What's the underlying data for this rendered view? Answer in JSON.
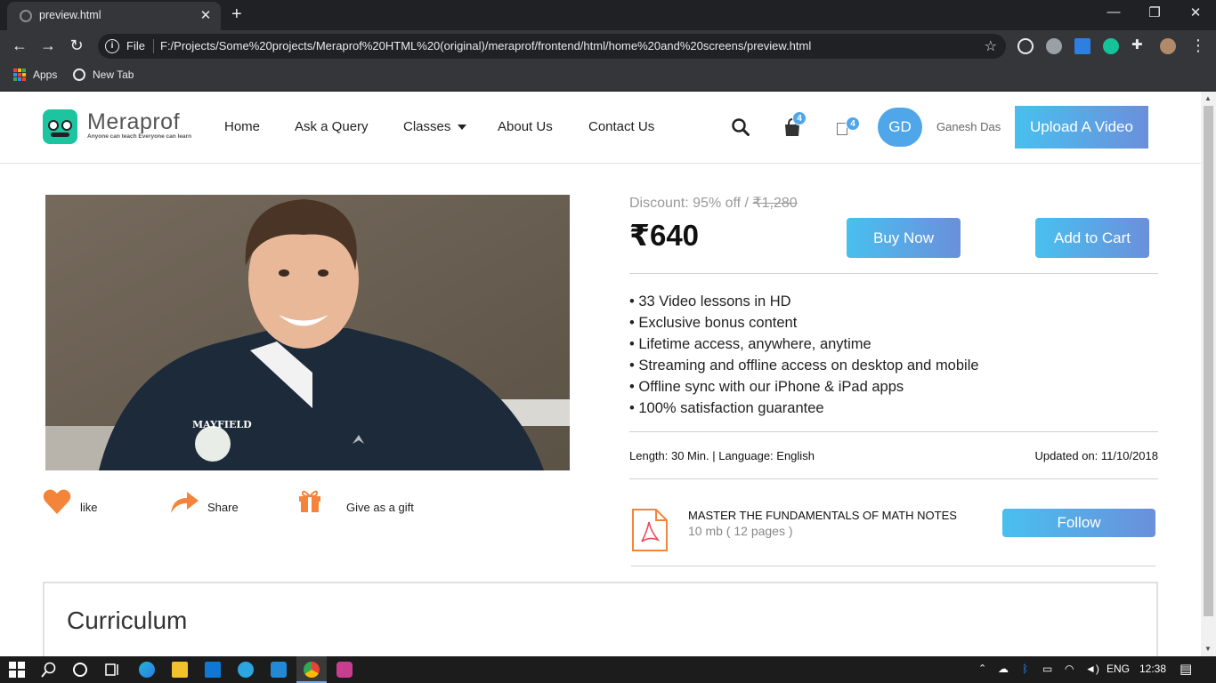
{
  "browser": {
    "tab_title": "preview.html",
    "url_scheme": "File",
    "url": "F:/Projects/Some%20projects/Meraprof%20HTML%20(original)/meraprof/frontend/html/home%20and%20screens/preview.html",
    "bookmarks": [
      {
        "label": "Apps"
      },
      {
        "label": "New Tab"
      }
    ]
  },
  "header": {
    "brand": "Meraprof",
    "tagline": "Anyone can teach Everyone can learn",
    "nav": [
      {
        "label": "Home"
      },
      {
        "label": "Ask a Query"
      },
      {
        "label": "Classes"
      },
      {
        "label": "About Us"
      },
      {
        "label": "Contact Us"
      }
    ],
    "bag_count": "4",
    "cart_count": "4",
    "avatar_initials": "GD",
    "user_name": "Ganesh Das",
    "upload_label": "Upload A Video"
  },
  "product": {
    "actions": [
      {
        "label": "like",
        "icon": "heart-icon"
      },
      {
        "label": "Share",
        "icon": "share-icon"
      },
      {
        "label": "Give as a gift",
        "icon": "gift-icon"
      }
    ],
    "discount_prefix": "Discount: 95% off / ",
    "original_price": "₹1,280",
    "price": "₹640",
    "buy_label": "Buy Now",
    "add_cart_label": "Add to Cart",
    "features": [
      "• 33 Video lessons in HD",
      "• Exclusive bonus content",
      "• Lifetime access, anywhere, anytime",
      "• Streaming and offline access on desktop and mobile",
      "• Offline sync with our iPhone & iPad apps",
      "• 100% satisfaction guarantee"
    ],
    "length_language": "Length: 30 Min. | Language: English",
    "updated": "Updated on: 11/10/2018",
    "notes_title": "MASTER THE FUNDAMENTALS OF MATH NOTES",
    "notes_meta": "10 mb ( 12 pages )",
    "follow_label": "Follow"
  },
  "curriculum": {
    "heading": "Curriculum"
  },
  "taskbar": {
    "language": "ENG",
    "time": "12:38"
  },
  "colors": {
    "accent_gradient_start": "#48c0ee",
    "accent_gradient_end": "#6b8fdc",
    "logo_green": "#1cc5a0",
    "heart_orange": "#f4843a"
  }
}
